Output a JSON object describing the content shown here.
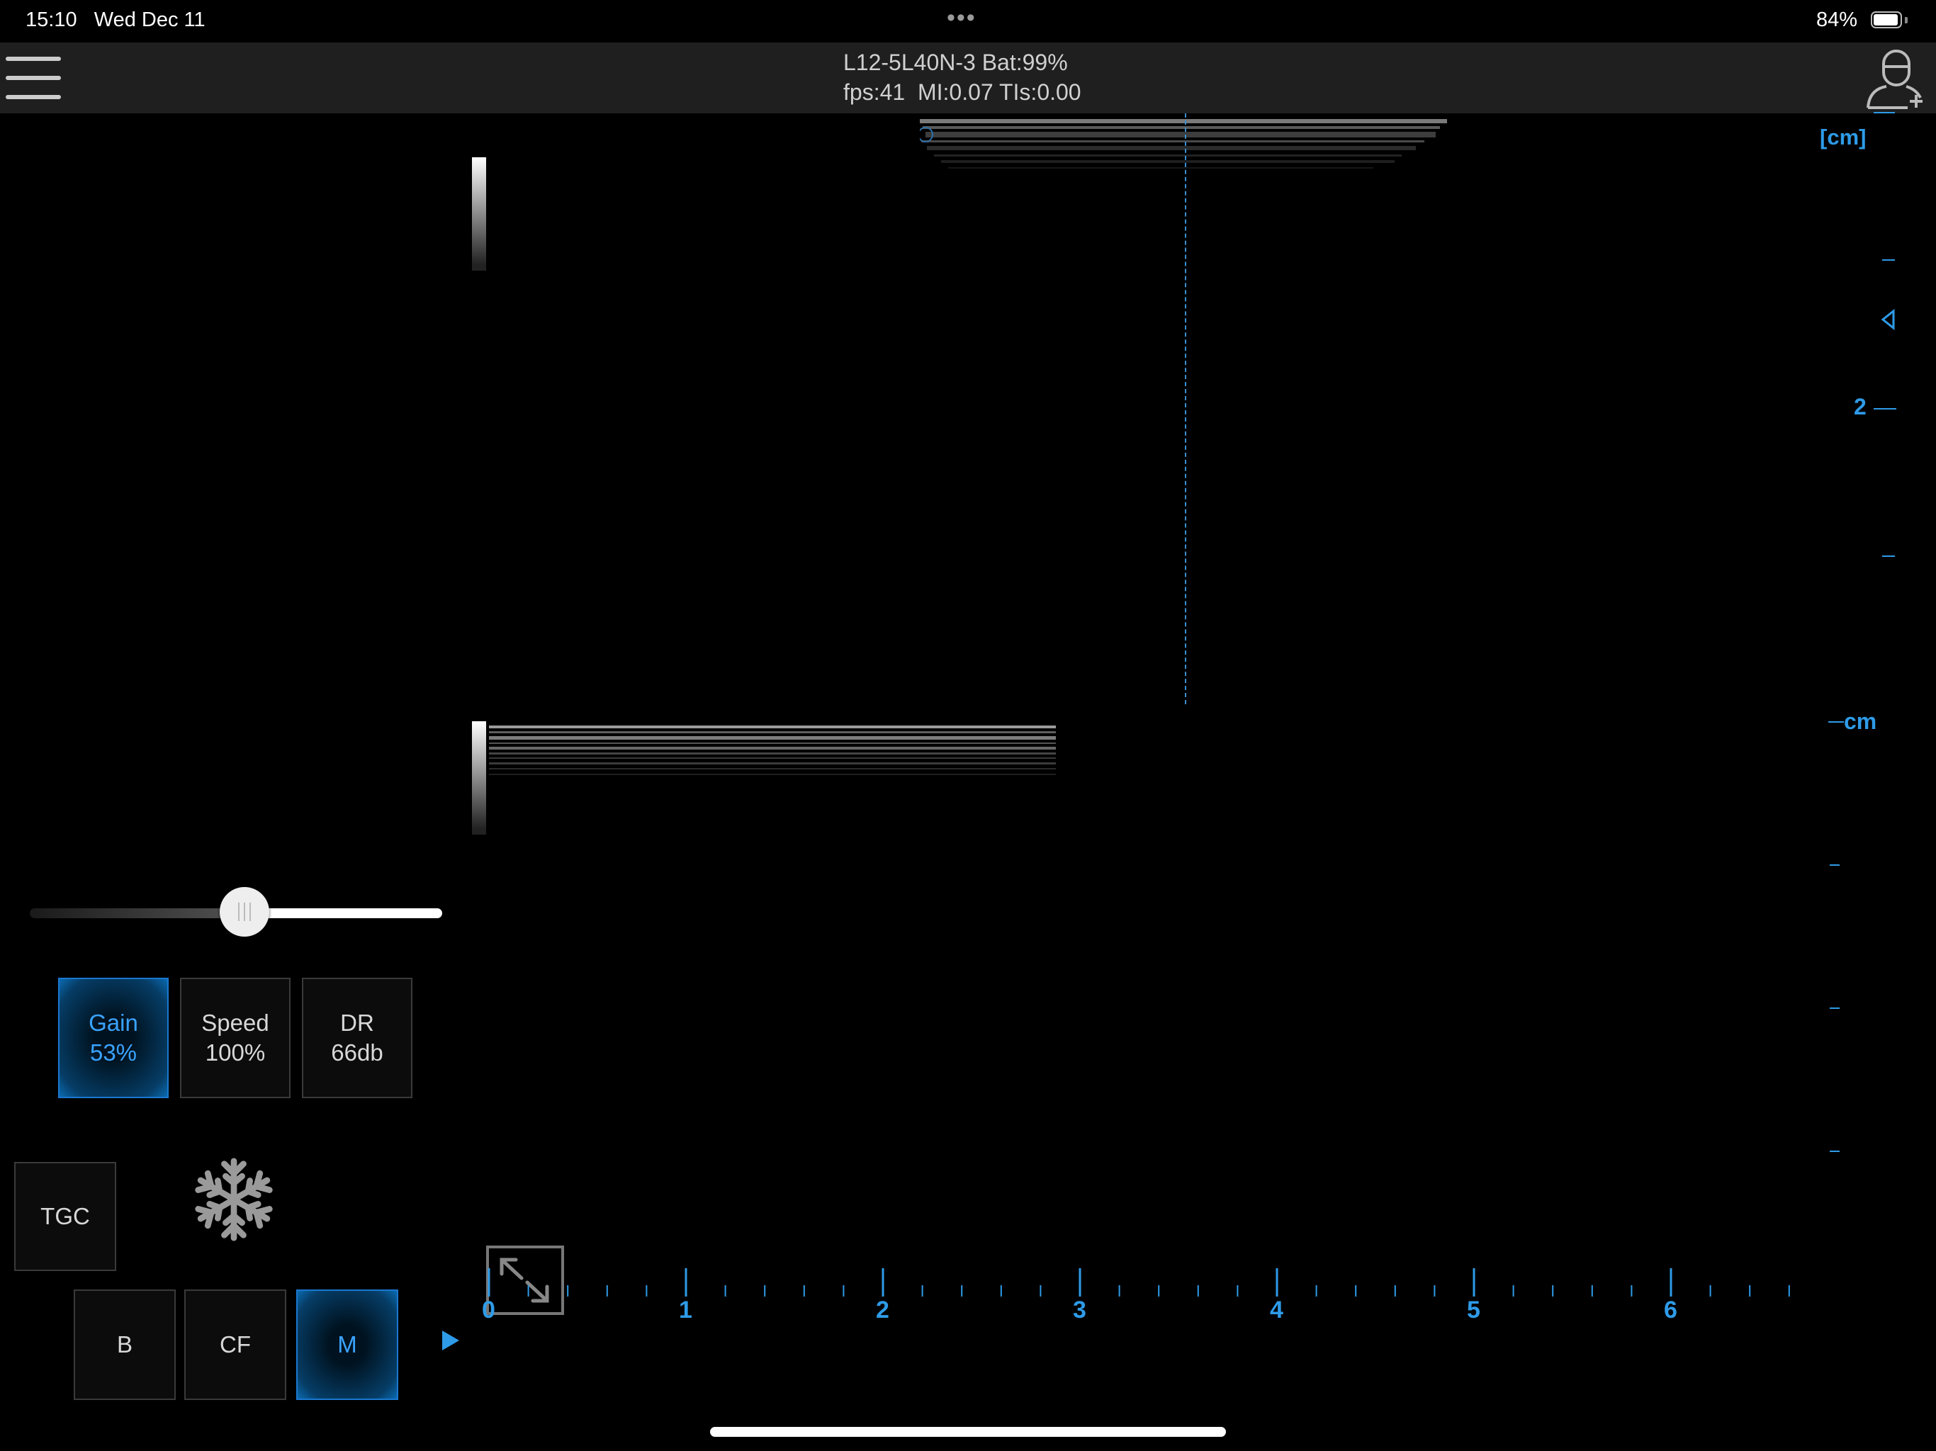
{
  "status_bar": {
    "time": "15:10",
    "date": "Wed Dec 11",
    "dots": "•••",
    "battery_pct": "84%"
  },
  "header": {
    "probe_info": "L12-5L40N-3 Bat:99%",
    "acquisition_info": "fps:41  MI:0.07 TIs:0.00"
  },
  "depth_scale": {
    "unit_label": "[cm]",
    "mark_2": "2",
    "m_unit_label": "cm"
  },
  "time_axis": {
    "labels": [
      "0",
      "1",
      "2",
      "3",
      "4",
      "5",
      "6"
    ]
  },
  "controls": {
    "gain": {
      "label": "Gain",
      "value": "53%",
      "fraction": 0.53
    },
    "speed": {
      "label": "Speed",
      "value": "100%"
    },
    "dr": {
      "label": "DR",
      "value": "66db"
    },
    "tgc_label": "TGC"
  },
  "modes": {
    "b_label": "B",
    "cf_label": "CF",
    "m_label": "M",
    "active": "M"
  },
  "colors": {
    "accent": "#2e9be8",
    "active_button_border": "#1a78d0",
    "top_bar": "#1f1f1f",
    "background": "#000000"
  },
  "icons": [
    "menu-icon",
    "add-patient-icon",
    "freeze-icon",
    "play-icon",
    "fullscreen-icon",
    "depth-marker-icon"
  ]
}
